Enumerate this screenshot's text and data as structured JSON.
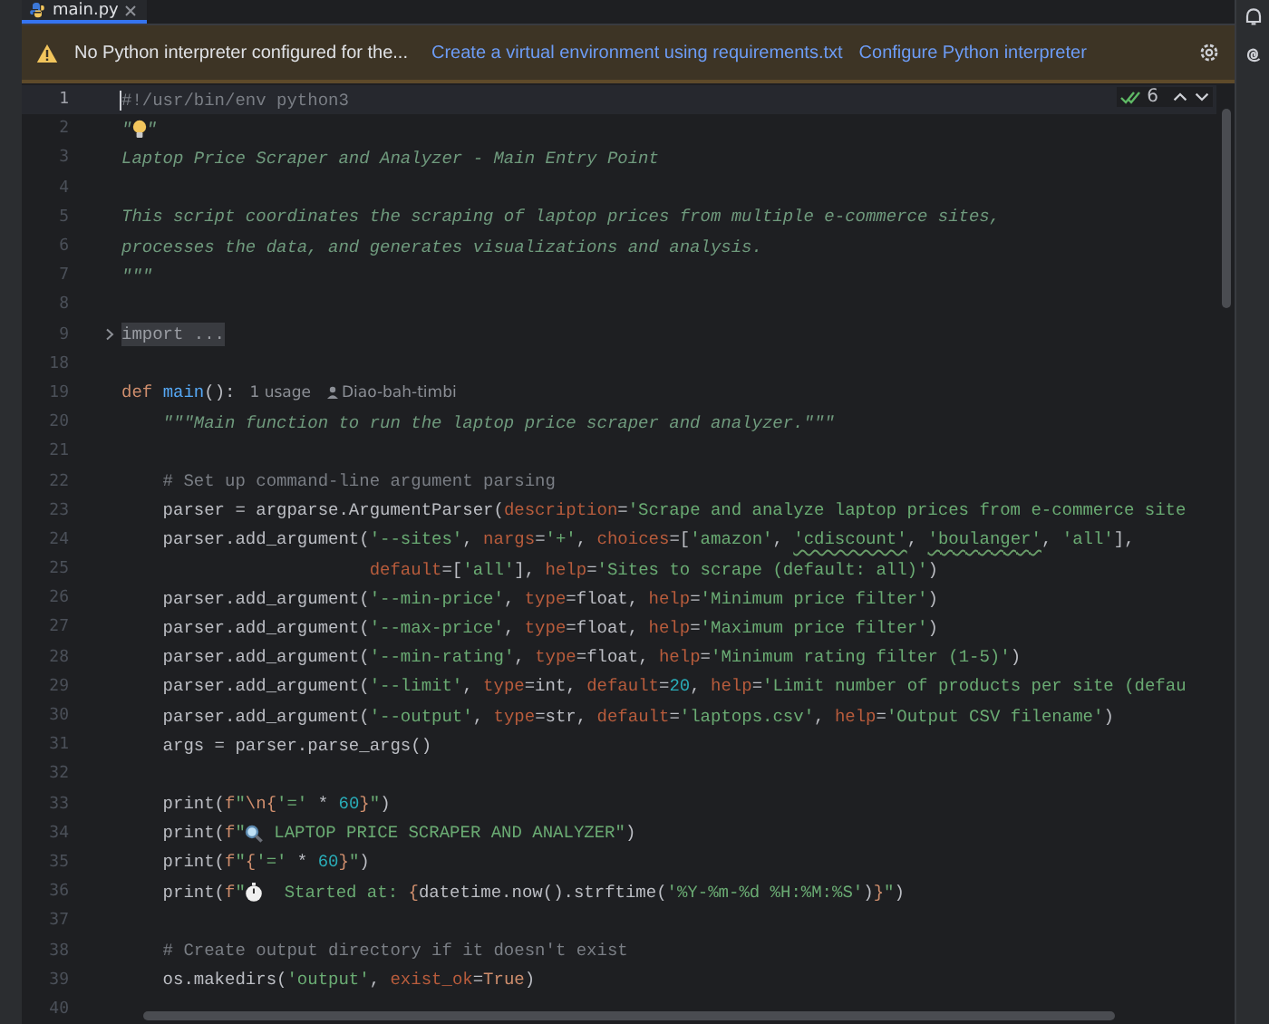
{
  "tabs": [
    {
      "label": "main.py",
      "selected": true
    }
  ],
  "banner": {
    "message": "No Python interpreter configured for the...",
    "links": [
      "Create a virtual environment using requirements.txt",
      "Configure Python interpreter"
    ]
  },
  "inspection": {
    "count": "6"
  },
  "lines": [
    {
      "number": "1",
      "current": true,
      "tokens": [
        {
          "text": "#!/usr/bin/env python3",
          "kind": "comment"
        }
      ]
    },
    {
      "number": "2",
      "current": false,
      "tokens": [
        {
          "text": "\"",
          "kind": "doc"
        },
        {
          "kind": "bulb"
        },
        {
          "text": "\"",
          "kind": "doc"
        }
      ]
    },
    {
      "number": "3",
      "current": false,
      "tokens": [
        {
          "text": "Laptop Price Scraper and Analyzer - Main Entry Point",
          "kind": "doc"
        }
      ]
    },
    {
      "number": "4",
      "current": false
    },
    {
      "number": "5",
      "current": false,
      "tokens": [
        {
          "text": "This script coordinates the scraping of laptop prices from multiple e-commerce sites,",
          "kind": "doc"
        }
      ]
    },
    {
      "number": "6",
      "current": false,
      "tokens": [
        {
          "text": "processes the data, and generates visualizations and analysis.",
          "kind": "doc"
        }
      ]
    },
    {
      "number": "7",
      "current": false,
      "tokens": [
        {
          "text": "\"\"\"",
          "kind": "doc"
        }
      ]
    },
    {
      "number": "8",
      "current": false
    },
    {
      "number": "9",
      "current": false,
      "tokens": [
        {
          "text": "import ...",
          "kind": "fold"
        }
      ]
    },
    {
      "number": "18",
      "current": false
    },
    {
      "number": "19",
      "current": false,
      "tokens": [
        {
          "text": "def ",
          "kind": "keyword"
        },
        {
          "text": "main",
          "kind": "defname"
        },
        {
          "text": "():",
          "kind": "plain"
        },
        {
          "text": "1 usage",
          "kind": "inlay"
        },
        {
          "text": "Diao-bah-timbi",
          "kind": "author"
        }
      ]
    },
    {
      "number": "20",
      "current": false,
      "tokens": [
        {
          "text": "    \"\"\"Main function to run the laptop price scraper and analyzer.\"\"\"",
          "kind": "doc"
        }
      ]
    },
    {
      "number": "21",
      "current": false
    },
    {
      "number": "22",
      "current": false,
      "tokens": [
        {
          "text": "    # Set up command-line argument parsing",
          "kind": "comment"
        }
      ]
    },
    {
      "number": "23",
      "current": false,
      "tokens": [
        {
          "text": "    parser = argparse.ArgumentParser(",
          "kind": "plain"
        },
        {
          "text": "description",
          "kind": "param"
        },
        {
          "text": "=",
          "kind": "plain"
        },
        {
          "text": "'Scrape and analyze laptop prices from e-commerce site",
          "kind": "string"
        }
      ]
    },
    {
      "number": "24",
      "current": false,
      "tokens": [
        {
          "text": "    parser.add_argument(",
          "kind": "plain"
        },
        {
          "text": "'--sites'",
          "kind": "string"
        },
        {
          "text": ", ",
          "kind": "plain"
        },
        {
          "text": "nargs",
          "kind": "param"
        },
        {
          "text": "=",
          "kind": "plain"
        },
        {
          "text": "'+'",
          "kind": "string"
        },
        {
          "text": ", ",
          "kind": "plain"
        },
        {
          "text": "choices",
          "kind": "param"
        },
        {
          "text": "=[",
          "kind": "plain"
        },
        {
          "text": "'amazon'",
          "kind": "string"
        },
        {
          "text": ", ",
          "kind": "plain"
        },
        {
          "text": "'cdiscount'",
          "kind": "typo"
        },
        {
          "text": ", ",
          "kind": "plain"
        },
        {
          "text": "'boulanger'",
          "kind": "typo"
        },
        {
          "text": ", ",
          "kind": "plain"
        },
        {
          "text": "'all'",
          "kind": "string"
        },
        {
          "text": "],",
          "kind": "plain"
        }
      ]
    },
    {
      "number": "25",
      "current": false,
      "tokens": [
        {
          "text": "                        default",
          "kind": "param"
        },
        {
          "text": "=[",
          "kind": "plain"
        },
        {
          "text": "'all'",
          "kind": "string"
        },
        {
          "text": "], ",
          "kind": "plain"
        },
        {
          "text": "help",
          "kind": "param"
        },
        {
          "text": "=",
          "kind": "plain"
        },
        {
          "text": "'Sites to scrape (default: all)'",
          "kind": "string"
        },
        {
          "text": ")",
          "kind": "plain"
        }
      ]
    },
    {
      "number": "26",
      "current": false,
      "tokens": [
        {
          "text": "    parser.add_argument(",
          "kind": "plain"
        },
        {
          "text": "'--min-price'",
          "kind": "string"
        },
        {
          "text": ", ",
          "kind": "plain"
        },
        {
          "text": "type",
          "kind": "param"
        },
        {
          "text": "=float, ",
          "kind": "plain"
        },
        {
          "text": "help",
          "kind": "param"
        },
        {
          "text": "=",
          "kind": "plain"
        },
        {
          "text": "'Minimum price filter'",
          "kind": "string"
        },
        {
          "text": ")",
          "kind": "plain"
        }
      ]
    },
    {
      "number": "27",
      "current": false,
      "tokens": [
        {
          "text": "    parser.add_argument(",
          "kind": "plain"
        },
        {
          "text": "'--max-price'",
          "kind": "string"
        },
        {
          "text": ", ",
          "kind": "plain"
        },
        {
          "text": "type",
          "kind": "param"
        },
        {
          "text": "=float, ",
          "kind": "plain"
        },
        {
          "text": "help",
          "kind": "param"
        },
        {
          "text": "=",
          "kind": "plain"
        },
        {
          "text": "'Maximum price filter'",
          "kind": "string"
        },
        {
          "text": ")",
          "kind": "plain"
        }
      ]
    },
    {
      "number": "28",
      "current": false,
      "tokens": [
        {
          "text": "    parser.add_argument(",
          "kind": "plain"
        },
        {
          "text": "'--min-rating'",
          "kind": "string"
        },
        {
          "text": ", ",
          "kind": "plain"
        },
        {
          "text": "type",
          "kind": "param"
        },
        {
          "text": "=float, ",
          "kind": "plain"
        },
        {
          "text": "help",
          "kind": "param"
        },
        {
          "text": "=",
          "kind": "plain"
        },
        {
          "text": "'Minimum rating filter (1-5)'",
          "kind": "string"
        },
        {
          "text": ")",
          "kind": "plain"
        }
      ]
    },
    {
      "number": "29",
      "current": false,
      "tokens": [
        {
          "text": "    parser.add_argument(",
          "kind": "plain"
        },
        {
          "text": "'--limit'",
          "kind": "string"
        },
        {
          "text": ", ",
          "kind": "plain"
        },
        {
          "text": "type",
          "kind": "param"
        },
        {
          "text": "=int, ",
          "kind": "plain"
        },
        {
          "text": "default",
          "kind": "param"
        },
        {
          "text": "=",
          "kind": "plain"
        },
        {
          "text": "20",
          "kind": "number"
        },
        {
          "text": ", ",
          "kind": "plain"
        },
        {
          "text": "help",
          "kind": "param"
        },
        {
          "text": "=",
          "kind": "plain"
        },
        {
          "text": "'Limit number of products per site (defau",
          "kind": "string"
        }
      ]
    },
    {
      "number": "30",
      "current": false,
      "tokens": [
        {
          "text": "    parser.add_argument(",
          "kind": "plain"
        },
        {
          "text": "'--output'",
          "kind": "string"
        },
        {
          "text": ", ",
          "kind": "plain"
        },
        {
          "text": "type",
          "kind": "param"
        },
        {
          "text": "=str, ",
          "kind": "plain"
        },
        {
          "text": "default",
          "kind": "param"
        },
        {
          "text": "=",
          "kind": "plain"
        },
        {
          "text": "'laptops.csv'",
          "kind": "string"
        },
        {
          "text": ", ",
          "kind": "plain"
        },
        {
          "text": "help",
          "kind": "param"
        },
        {
          "text": "=",
          "kind": "plain"
        },
        {
          "text": "'Output CSV filename'",
          "kind": "string"
        },
        {
          "text": ")",
          "kind": "plain"
        }
      ]
    },
    {
      "number": "31",
      "current": false,
      "tokens": [
        {
          "text": "    args = parser.parse_args()",
          "kind": "plain"
        }
      ]
    },
    {
      "number": "32",
      "current": false
    },
    {
      "number": "33",
      "current": false,
      "tokens": [
        {
          "text": "    print(",
          "kind": "plain"
        },
        {
          "text": "f",
          "kind": "keyword"
        },
        {
          "text": "\"",
          "kind": "string"
        },
        {
          "text": "\\n",
          "kind": "keyword"
        },
        {
          "text": "{",
          "kind": "keyword"
        },
        {
          "text": "'='",
          "kind": "string"
        },
        {
          "text": " * ",
          "kind": "plain"
        },
        {
          "text": "60",
          "kind": "number"
        },
        {
          "text": "}",
          "kind": "keyword"
        },
        {
          "text": "\"",
          "kind": "string"
        },
        {
          "text": ")",
          "kind": "plain"
        }
      ]
    },
    {
      "number": "34",
      "current": false,
      "tokens": [
        {
          "text": "    print(",
          "kind": "plain"
        },
        {
          "text": "f",
          "kind": "keyword"
        },
        {
          "text": "\"",
          "kind": "string"
        },
        {
          "kind": "magnifier"
        },
        {
          "text": " LAPTOP PRICE SCRAPER AND ANALYZER\"",
          "kind": "string"
        },
        {
          "text": ")",
          "kind": "plain"
        }
      ]
    },
    {
      "number": "35",
      "current": false,
      "tokens": [
        {
          "text": "    print(",
          "kind": "plain"
        },
        {
          "text": "f",
          "kind": "keyword"
        },
        {
          "text": "\"",
          "kind": "string"
        },
        {
          "text": "{",
          "kind": "keyword"
        },
        {
          "text": "'='",
          "kind": "string"
        },
        {
          "text": " * ",
          "kind": "plain"
        },
        {
          "text": "60",
          "kind": "number"
        },
        {
          "text": "}",
          "kind": "keyword"
        },
        {
          "text": "\"",
          "kind": "string"
        },
        {
          "text": ")",
          "kind": "plain"
        }
      ]
    },
    {
      "number": "36",
      "current": false,
      "tokens": [
        {
          "text": "    print(",
          "kind": "plain"
        },
        {
          "text": "f",
          "kind": "keyword"
        },
        {
          "text": "\"",
          "kind": "string"
        },
        {
          "kind": "stopwatch"
        },
        {
          "text": "  Started at: ",
          "kind": "string"
        },
        {
          "text": "{",
          "kind": "keyword"
        },
        {
          "text": "datetime.now().strftime(",
          "kind": "plain"
        },
        {
          "text": "'%Y-%m-%d %H:%M:%S'",
          "kind": "string"
        },
        {
          "text": ")",
          "kind": "plain"
        },
        {
          "text": "}",
          "kind": "keyword"
        },
        {
          "text": "\"",
          "kind": "string"
        },
        {
          "text": ")",
          "kind": "plain"
        }
      ]
    },
    {
      "number": "37",
      "current": false
    },
    {
      "number": "38",
      "current": false,
      "tokens": [
        {
          "text": "    # Create output directory if it doesn't exist",
          "kind": "comment"
        }
      ]
    },
    {
      "number": "39",
      "current": false,
      "tokens": [
        {
          "text": "    os.makedirs(",
          "kind": "plain"
        },
        {
          "text": "'output'",
          "kind": "string"
        },
        {
          "text": ", ",
          "kind": "plain"
        },
        {
          "text": "exist_ok",
          "kind": "param"
        },
        {
          "text": "=",
          "kind": "plain"
        },
        {
          "text": "True",
          "kind": "keyword"
        },
        {
          "text": ")",
          "kind": "plain"
        }
      ]
    },
    {
      "number": "40",
      "current": false
    }
  ]
}
